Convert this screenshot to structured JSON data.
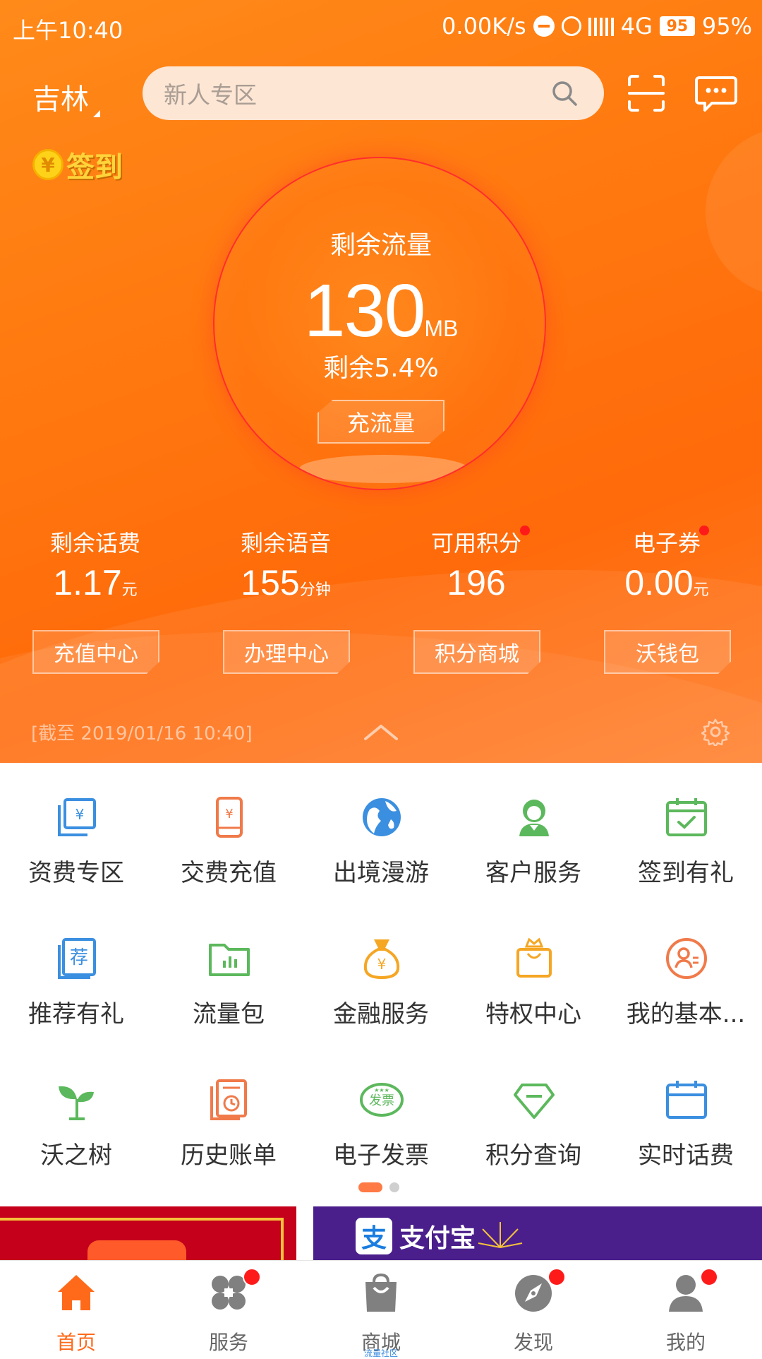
{
  "status_bar": {
    "time": "上午10:40",
    "net_speed": "0.00K/s",
    "network": "4G",
    "battery_level": "95",
    "battery_percent": "95%"
  },
  "header": {
    "city": "吉林",
    "search_placeholder": "新人专区",
    "checkin_label": "签到",
    "checkin_coin": "¥"
  },
  "data_flow": {
    "title": "剩余流量",
    "value": "130",
    "unit": "MB",
    "percent_text": "剩余5.4%",
    "recharge_button": "充流量"
  },
  "stats": [
    {
      "label": "剩余话费",
      "value": "1.17",
      "unit": "元",
      "badge": false
    },
    {
      "label": "剩余语音",
      "value": "155",
      "unit": "分钟",
      "badge": false
    },
    {
      "label": "可用积分",
      "value": "196",
      "unit": "",
      "badge": true
    },
    {
      "label": "电子券",
      "value": "0.00",
      "unit": "元",
      "badge": true
    }
  ],
  "actions": [
    "充值中心",
    "办理中心",
    "积分商城",
    "沃钱包"
  ],
  "timestamp": "[截至 2019/01/16 10:40]",
  "services": [
    {
      "label": "资费专区",
      "icon": "tariff-icon",
      "color": "#3b8fe0"
    },
    {
      "label": "交费充值",
      "icon": "phone-pay-icon",
      "color": "#f07a4a"
    },
    {
      "label": "出境漫游",
      "icon": "globe-icon",
      "color": "#3b8fe0"
    },
    {
      "label": "客户服务",
      "icon": "customer-service-icon",
      "color": "#5cb85c"
    },
    {
      "label": "签到有礼",
      "icon": "calendar-check-icon",
      "color": "#5cb85c"
    },
    {
      "label": "推荐有礼",
      "icon": "recommend-icon",
      "color": "#3b8fe0"
    },
    {
      "label": "流量包",
      "icon": "folder-chart-icon",
      "color": "#5cb85c"
    },
    {
      "label": "金融服务",
      "icon": "money-bag-icon",
      "color": "#f5a623"
    },
    {
      "label": "特权中心",
      "icon": "crown-bag-icon",
      "color": "#f5a623"
    },
    {
      "label": "我的基本...",
      "icon": "user-info-icon",
      "color": "#f07a4a"
    },
    {
      "label": "沃之树",
      "icon": "sprout-icon",
      "color": "#5cb85c"
    },
    {
      "label": "历史账单",
      "icon": "bill-history-icon",
      "color": "#f07a4a"
    },
    {
      "label": "电子发票",
      "icon": "invoice-icon",
      "color": "#5cb85c"
    },
    {
      "label": "积分查询",
      "icon": "diamond-icon",
      "color": "#5cb85c"
    },
    {
      "label": "实时话费",
      "icon": "calendar-icon",
      "color": "#3b8fe0"
    }
  ],
  "invoice_badge": "发票",
  "banners": {
    "alipay_logo": "支",
    "alipay_name": "支付宝"
  },
  "tabs": [
    {
      "label": "首页",
      "icon": "home-icon",
      "active": true,
      "badge": false
    },
    {
      "label": "服务",
      "icon": "services-icon",
      "active": false,
      "badge": true
    },
    {
      "label": "商城",
      "icon": "shopping-bag-icon",
      "active": false,
      "badge": false,
      "sub": "流量社区"
    },
    {
      "label": "发现",
      "icon": "compass-icon",
      "active": false,
      "badge": true
    },
    {
      "label": "我的",
      "icon": "profile-icon",
      "active": false,
      "badge": true
    }
  ],
  "colors": {
    "brand_orange": "#ff7a10",
    "active_tab": "#ff6a1a",
    "badge_red": "#ff1a1a"
  }
}
